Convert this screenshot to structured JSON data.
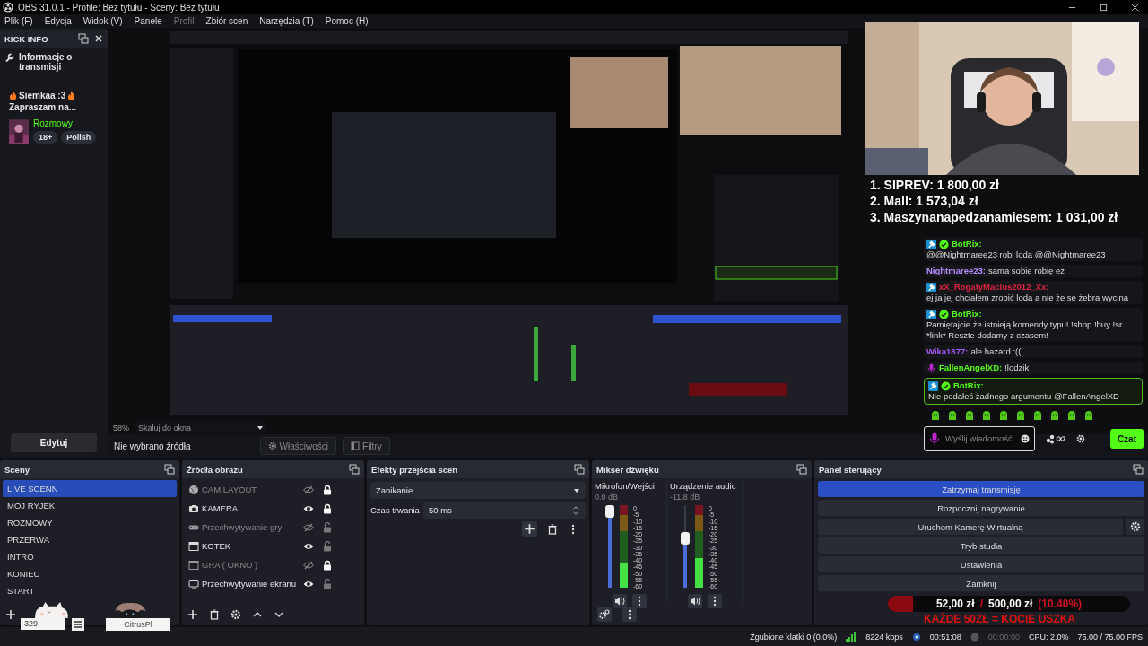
{
  "window": {
    "title": "OBS 31.0.1 - Profile: Bez tytułu - Sceny: Bez tytułu"
  },
  "menu": [
    {
      "label": "Plik (F)",
      "disabled": false
    },
    {
      "label": "Edycja",
      "disabled": false
    },
    {
      "label": "Widok (V)",
      "disabled": false
    },
    {
      "label": "Panele",
      "disabled": false
    },
    {
      "label": "Profil",
      "disabled": true
    },
    {
      "label": "Zbiór scen",
      "disabled": false
    },
    {
      "label": "Narzędzia (T)",
      "disabled": false
    },
    {
      "label": "Pomoc (H)",
      "disabled": false
    }
  ],
  "kick_info": {
    "title": "KICK INFO",
    "heading": "Informacje o transmisji",
    "stream_title": "Siemkaa :3",
    "stream_subtitle": "Zapraszam na...",
    "category": "Rozmowy",
    "tags": [
      "18+",
      "Polish"
    ],
    "edit_button": "Edytuj"
  },
  "preview": {
    "zoom": "58%",
    "scale_mode": "Skaluj do okna"
  },
  "ranking": [
    "1. SIPREV: 1 800,00 zł",
    "2. Mall: 1 573,04 zł",
    "3. Maszynanapedzanamiesem: 1 031,00 zł"
  ],
  "chat": {
    "messages": [
      {
        "user": "BotRix:",
        "color": "#53fc18",
        "moderator": true,
        "verified": true,
        "microphone": false,
        "text": "@@Nightmaree23 robi loda @@Nightmaree23",
        "highlighted": false
      },
      {
        "user": "Nightmaree23:",
        "color": "#b78cff",
        "moderator": false,
        "verified": false,
        "microphone": false,
        "text": "sama sobie robię ez",
        "highlighted": false
      },
      {
        "user": "xX_RogatyMaclus2012_Xx:",
        "color": "#e0243f",
        "moderator": true,
        "verified": false,
        "microphone": false,
        "text": "ej ja jej chciałem zrobić loda a nie że se żebra wycina",
        "highlighted": false
      },
      {
        "user": "BotRix:",
        "color": "#53fc18",
        "moderator": true,
        "verified": true,
        "microphone": false,
        "text": "Pamiętajcie że istnieją komendy typu! !shop !buy !sr *link* Reszte dodamy z czasem!",
        "highlighted": false
      },
      {
        "user": "Wika1877:",
        "color": "#a855f7",
        "moderator": false,
        "verified": false,
        "microphone": false,
        "text": "ale hazard :((",
        "highlighted": false
      },
      {
        "user": "FallenAngelXD:",
        "color": "#53fc18",
        "moderator": false,
        "verified": false,
        "microphone": true,
        "text": "!lodzik",
        "highlighted": false
      },
      {
        "user": "BotRix:",
        "color": "#53fc18",
        "moderator": true,
        "verified": true,
        "microphone": false,
        "text": "Nie podałeś żadnego argumentu @FallenAngelXD",
        "highlighted": true
      }
    ],
    "placeholder": "Wyślij wiadomość",
    "send_button": "Czat"
  },
  "source_bar": {
    "status": "Nie wybrano źródła",
    "properties": "Właściwości",
    "filters": "Filtry"
  },
  "scenes": {
    "title": "Sceny",
    "items": [
      {
        "name": "LIVE SCENN",
        "selected": true
      },
      {
        "name": "MÓJ RYJEK",
        "selected": false
      },
      {
        "name": "ROZMOWY",
        "selected": false
      },
      {
        "name": "PRZERWA",
        "selected": false
      },
      {
        "name": "INTRO",
        "selected": false
      },
      {
        "name": "KONIEC",
        "selected": false
      },
      {
        "name": "START",
        "selected": false
      }
    ]
  },
  "sources": {
    "title": "Źródła obrazu",
    "items": [
      {
        "name": "CAM LAYOUT",
        "kind": "browser",
        "visible": false,
        "locked": true
      },
      {
        "name": "KAMERA",
        "kind": "camera",
        "visible": true,
        "locked": true
      },
      {
        "name": "Przechwytywanie gry",
        "kind": "game",
        "visible": false,
        "locked": false
      },
      {
        "name": "KOTEK",
        "kind": "window",
        "visible": true,
        "locked": false
      },
      {
        "name": "GRA ( OKNO )",
        "kind": "window",
        "visible": false,
        "locked": true
      },
      {
        "name": "Przechwytywanie ekranu",
        "kind": "display",
        "visible": true,
        "locked": false
      }
    ]
  },
  "transitions": {
    "title": "Efekty przejścia scen",
    "effect": "Zanikanie",
    "duration_label": "Czas trwania",
    "duration": "50 ms"
  },
  "mixer": {
    "title": "Mikser dźwięku",
    "channels": [
      {
        "name": "Mikrofon/Wejści",
        "reading": "0.0 dB",
        "fader": {
          "level": 1.0
        },
        "meter": {
          "level": 0.3
        },
        "scale": [
          "0",
          "-5",
          "-10",
          "-15",
          "-20",
          "-25",
          "-30",
          "-35",
          "-40",
          "-45",
          "-50",
          "-55",
          "-60"
        ]
      },
      {
        "name": "Urządzenie audic",
        "reading": "-11.8 dB",
        "fader": {
          "level": 0.62
        },
        "meter": {
          "level": 0.36
        },
        "scale": [
          "0",
          "-5",
          "-10",
          "-15",
          "-20",
          "-25",
          "-30",
          "-35",
          "-40",
          "-45",
          "-50",
          "-55",
          "-60"
        ]
      }
    ]
  },
  "controls": {
    "title": "Panel sterujący",
    "buttons": [
      {
        "label": "Zatrzymaj transmisję",
        "kind": "plain",
        "selected": true
      },
      {
        "label": "Rozpocznij nagrywanie",
        "kind": "plain",
        "selected": false
      },
      {
        "label": "Uruchom Kamerę Wirtualną",
        "kind": "with-settings",
        "selected": false
      },
      {
        "label": "Tryb studia",
        "kind": "plain",
        "selected": false
      },
      {
        "label": "Ustawienia",
        "kind": "plain",
        "selected": false
      },
      {
        "label": "Zamknij",
        "kind": "plain",
        "selected": false
      }
    ]
  },
  "status_bar": {
    "dropped": "Zgubione klatki 0 (0.0%)",
    "bitrate": "8224 kbps",
    "stream_time": "00:51:08",
    "record_time": "00:00:00",
    "cpu": "CPU: 2.0%",
    "fps": "75.00 / 75.00 FPS"
  },
  "overlays": {
    "sticker_count": "329",
    "sticker_name": "CitrusPl",
    "goal": {
      "amount": "52,00 zł",
      "separator": "/",
      "target": "500,00 zł",
      "percent": "(10.40%)",
      "level": 0.104,
      "note": "KAŻDE 50ZŁ = KOCIE USZKA"
    }
  }
}
